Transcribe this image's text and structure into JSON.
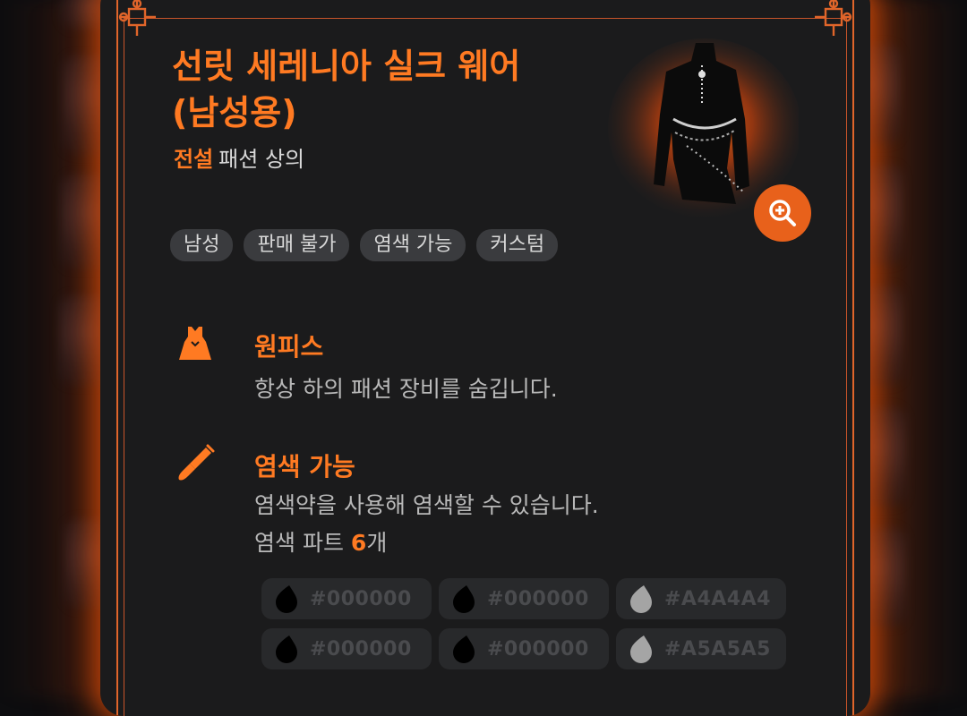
{
  "item": {
    "title": "선릿 세레니아 실크 웨어 (남성용)",
    "grade": "전설",
    "category": "패션 상의"
  },
  "tags": [
    "남성",
    "판매 불가",
    "염색 가능",
    "커스텀"
  ],
  "zoom_icon": "magnify-plus-icon",
  "sections": {
    "onepiece": {
      "icon": "dress-icon",
      "title": "원피스",
      "desc": "항상 하의 패션 장비를 숨깁니다."
    },
    "dye": {
      "icon": "dye-brush-icon",
      "title": "염색 가능",
      "desc": "염색약을 사용해 염색할 수 있습니다.",
      "parts_prefix": "염색 파트 ",
      "parts_count": "6",
      "parts_suffix": "개"
    }
  },
  "dye_colors": [
    {
      "hex": "#000000",
      "swatch": "#000000"
    },
    {
      "hex": "#000000",
      "swatch": "#000000"
    },
    {
      "hex": "#A4A4A4",
      "swatch": "#A4A4A4"
    },
    {
      "hex": "#000000",
      "swatch": "#000000"
    },
    {
      "hex": "#000000",
      "swatch": "#000000"
    },
    {
      "hex": "#A5A5A5",
      "swatch": "#A5A5A5"
    }
  ],
  "accent_color": "#FF7A22"
}
